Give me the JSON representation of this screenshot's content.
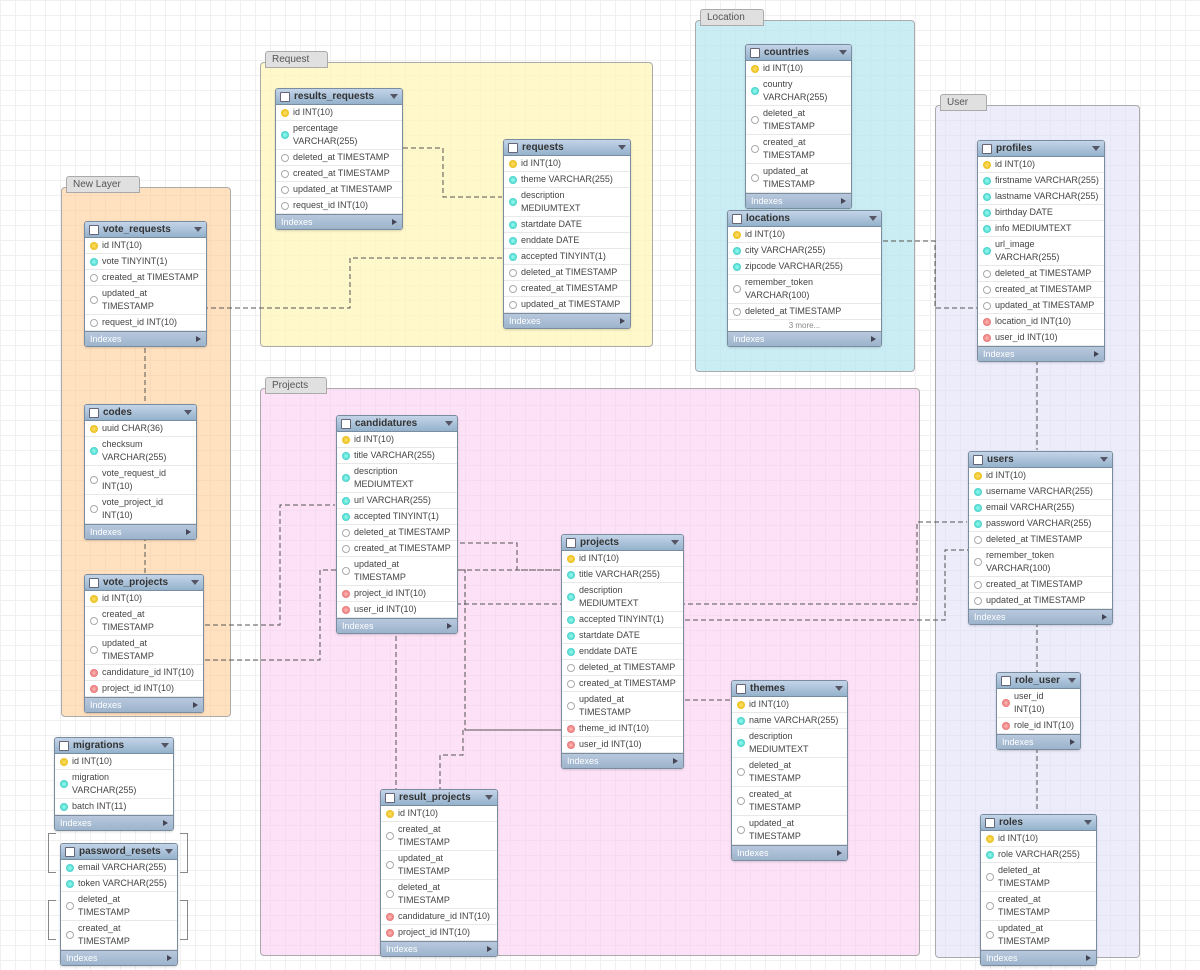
{
  "layers": {
    "new_layer": {
      "label": "New Layer"
    },
    "request": {
      "label": "Request"
    },
    "location": {
      "label": "Location"
    },
    "projects": {
      "label": "Projects"
    },
    "user": {
      "label": "User"
    }
  },
  "tables": {
    "vote_requests": {
      "title": "vote_requests",
      "rows": [
        {
          "t": "key",
          "txt": "id INT(10)"
        },
        {
          "t": "col",
          "txt": "vote TINYINT(1)"
        },
        {
          "t": "opt",
          "txt": "created_at TIMESTAMP"
        },
        {
          "t": "opt",
          "txt": "updated_at TIMESTAMP"
        },
        {
          "t": "opt",
          "txt": "request_id INT(10)"
        }
      ],
      "idx": "Indexes"
    },
    "codes": {
      "title": "codes",
      "rows": [
        {
          "t": "key",
          "txt": "uuid CHAR(36)"
        },
        {
          "t": "col",
          "txt": "checksum VARCHAR(255)"
        },
        {
          "t": "opt",
          "txt": "vote_request_id INT(10)"
        },
        {
          "t": "opt",
          "txt": "vote_project_id INT(10)"
        }
      ],
      "idx": "Indexes"
    },
    "vote_projects": {
      "title": "vote_projects",
      "rows": [
        {
          "t": "key",
          "txt": "id INT(10)"
        },
        {
          "t": "opt",
          "txt": "created_at TIMESTAMP"
        },
        {
          "t": "opt",
          "txt": "updated_at TIMESTAMP"
        },
        {
          "t": "fk",
          "txt": "candidature_id INT(10)"
        },
        {
          "t": "fk",
          "txt": "project_id INT(10)"
        }
      ],
      "idx": "Indexes"
    },
    "results_requests": {
      "title": "results_requests",
      "rows": [
        {
          "t": "key",
          "txt": "id INT(10)"
        },
        {
          "t": "col",
          "txt": "percentage VARCHAR(255)"
        },
        {
          "t": "opt",
          "txt": "deleted_at TIMESTAMP"
        },
        {
          "t": "opt",
          "txt": "created_at TIMESTAMP"
        },
        {
          "t": "opt",
          "txt": "updated_at TIMESTAMP"
        },
        {
          "t": "opt",
          "txt": "request_id INT(10)"
        }
      ],
      "idx": "Indexes"
    },
    "requests": {
      "title": "requests",
      "rows": [
        {
          "t": "key",
          "txt": "id INT(10)"
        },
        {
          "t": "col",
          "txt": "theme VARCHAR(255)"
        },
        {
          "t": "col",
          "txt": "description MEDIUMTEXT"
        },
        {
          "t": "col",
          "txt": "startdate DATE"
        },
        {
          "t": "col",
          "txt": "enddate DATE"
        },
        {
          "t": "col",
          "txt": "accepted TINYINT(1)"
        },
        {
          "t": "opt",
          "txt": "deleted_at TIMESTAMP"
        },
        {
          "t": "opt",
          "txt": "created_at TIMESTAMP"
        },
        {
          "t": "opt",
          "txt": "updated_at TIMESTAMP"
        }
      ],
      "idx": "Indexes"
    },
    "countries": {
      "title": "countries",
      "rows": [
        {
          "t": "key",
          "txt": "id INT(10)"
        },
        {
          "t": "col",
          "txt": "country VARCHAR(255)"
        },
        {
          "t": "opt",
          "txt": "deleted_at TIMESTAMP"
        },
        {
          "t": "opt",
          "txt": "created_at TIMESTAMP"
        },
        {
          "t": "opt",
          "txt": "updated_at TIMESTAMP"
        }
      ],
      "idx": "Indexes"
    },
    "locations": {
      "title": "locations",
      "rows": [
        {
          "t": "key",
          "txt": "id INT(10)"
        },
        {
          "t": "col",
          "txt": "city VARCHAR(255)"
        },
        {
          "t": "col",
          "txt": "zipcode VARCHAR(255)"
        },
        {
          "t": "opt",
          "txt": "remember_token VARCHAR(100)"
        },
        {
          "t": "opt",
          "txt": "deleted_at TIMESTAMP"
        }
      ],
      "more": "3 more...",
      "idx": "Indexes"
    },
    "profiles": {
      "title": "profiles",
      "rows": [
        {
          "t": "key",
          "txt": "id INT(10)"
        },
        {
          "t": "col",
          "txt": "firstname VARCHAR(255)"
        },
        {
          "t": "col",
          "txt": "lastname VARCHAR(255)"
        },
        {
          "t": "col",
          "txt": "birthday DATE"
        },
        {
          "t": "col",
          "txt": "info MEDIUMTEXT"
        },
        {
          "t": "col",
          "txt": "url_image VARCHAR(255)"
        },
        {
          "t": "opt",
          "txt": "deleted_at TIMESTAMP"
        },
        {
          "t": "opt",
          "txt": "created_at TIMESTAMP"
        },
        {
          "t": "opt",
          "txt": "updated_at TIMESTAMP"
        },
        {
          "t": "fk",
          "txt": "location_id INT(10)"
        },
        {
          "t": "fk",
          "txt": "user_id INT(10)"
        }
      ],
      "idx": "Indexes"
    },
    "users": {
      "title": "users",
      "rows": [
        {
          "t": "key",
          "txt": "id INT(10)"
        },
        {
          "t": "col",
          "txt": "username VARCHAR(255)"
        },
        {
          "t": "col",
          "txt": "email VARCHAR(255)"
        },
        {
          "t": "col",
          "txt": "password VARCHAR(255)"
        },
        {
          "t": "opt",
          "txt": "deleted_at TIMESTAMP"
        },
        {
          "t": "opt",
          "txt": "remember_token VARCHAR(100)"
        },
        {
          "t": "opt",
          "txt": "created_at TIMESTAMP"
        },
        {
          "t": "opt",
          "txt": "updated_at TIMESTAMP"
        }
      ],
      "idx": "Indexes"
    },
    "role_user": {
      "title": "role_user",
      "rows": [
        {
          "t": "fk",
          "txt": "user_id INT(10)"
        },
        {
          "t": "fk",
          "txt": "role_id INT(10)"
        }
      ],
      "idx": "Indexes"
    },
    "roles": {
      "title": "roles",
      "rows": [
        {
          "t": "key",
          "txt": "id INT(10)"
        },
        {
          "t": "col",
          "txt": "role VARCHAR(255)"
        },
        {
          "t": "opt",
          "txt": "deleted_at TIMESTAMP"
        },
        {
          "t": "opt",
          "txt": "created_at TIMESTAMP"
        },
        {
          "t": "opt",
          "txt": "updated_at TIMESTAMP"
        }
      ],
      "idx": "Indexes"
    },
    "candidatures": {
      "title": "candidatures",
      "rows": [
        {
          "t": "key",
          "txt": "id INT(10)"
        },
        {
          "t": "col",
          "txt": "title VARCHAR(255)"
        },
        {
          "t": "col",
          "txt": "description MEDIUMTEXT"
        },
        {
          "t": "col",
          "txt": "url VARCHAR(255)"
        },
        {
          "t": "col",
          "txt": "accepted TINYINT(1)"
        },
        {
          "t": "opt",
          "txt": "deleted_at TIMESTAMP"
        },
        {
          "t": "opt",
          "txt": "created_at TIMESTAMP"
        },
        {
          "t": "opt",
          "txt": "updated_at TIMESTAMP"
        },
        {
          "t": "fk",
          "txt": "project_id INT(10)"
        },
        {
          "t": "fk",
          "txt": "user_id INT(10)"
        }
      ],
      "idx": "Indexes"
    },
    "projects": {
      "title": "projects",
      "rows": [
        {
          "t": "key",
          "txt": "id INT(10)"
        },
        {
          "t": "col",
          "txt": "title VARCHAR(255)"
        },
        {
          "t": "col",
          "txt": "description MEDIUMTEXT"
        },
        {
          "t": "col",
          "txt": "accepted TINYINT(1)"
        },
        {
          "t": "col",
          "txt": "startdate DATE"
        },
        {
          "t": "col",
          "txt": "enddate DATE"
        },
        {
          "t": "opt",
          "txt": "deleted_at TIMESTAMP"
        },
        {
          "t": "opt",
          "txt": "created_at TIMESTAMP"
        },
        {
          "t": "opt",
          "txt": "updated_at TIMESTAMP"
        },
        {
          "t": "fk",
          "txt": "theme_id INT(10)"
        },
        {
          "t": "fk",
          "txt": "user_id INT(10)"
        }
      ],
      "idx": "Indexes"
    },
    "themes": {
      "title": "themes",
      "rows": [
        {
          "t": "key",
          "txt": "id INT(10)"
        },
        {
          "t": "col",
          "txt": "name VARCHAR(255)"
        },
        {
          "t": "col",
          "txt": "description MEDIUMTEXT"
        },
        {
          "t": "opt",
          "txt": "deleted_at TIMESTAMP"
        },
        {
          "t": "opt",
          "txt": "created_at TIMESTAMP"
        },
        {
          "t": "opt",
          "txt": "updated_at TIMESTAMP"
        }
      ],
      "idx": "Indexes"
    },
    "result_projects": {
      "title": "result_projects",
      "rows": [
        {
          "t": "key",
          "txt": "id INT(10)"
        },
        {
          "t": "opt",
          "txt": "created_at TIMESTAMP"
        },
        {
          "t": "opt",
          "txt": "updated_at TIMESTAMP"
        },
        {
          "t": "opt",
          "txt": "deleted_at TIMESTAMP"
        },
        {
          "t": "fk",
          "txt": "candidature_id INT(10)"
        },
        {
          "t": "fk",
          "txt": "project_id INT(10)"
        }
      ],
      "idx": "Indexes"
    },
    "migrations": {
      "title": "migrations",
      "rows": [
        {
          "t": "key",
          "txt": "id INT(10)"
        },
        {
          "t": "col",
          "txt": "migration VARCHAR(255)"
        },
        {
          "t": "col",
          "txt": "batch INT(11)"
        }
      ],
      "idx": "Indexes"
    },
    "password_resets": {
      "title": "password_resets",
      "rows": [
        {
          "t": "col",
          "txt": "email VARCHAR(255)"
        },
        {
          "t": "col",
          "txt": "token VARCHAR(255)"
        },
        {
          "t": "opt",
          "txt": "deleted_at TIMESTAMP"
        },
        {
          "t": "opt",
          "txt": "created_at TIMESTAMP"
        }
      ],
      "idx": "Indexes"
    }
  }
}
